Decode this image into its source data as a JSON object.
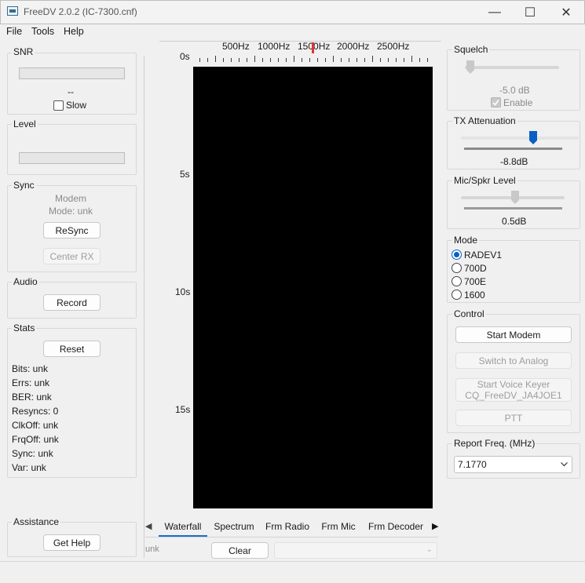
{
  "window": {
    "title": "FreeDV 2.0.2 (IC-7300.cnf)",
    "controls": {
      "minimize": "—",
      "maximize": "☐",
      "close": "✕"
    }
  },
  "menu": [
    "File",
    "Tools",
    "Help"
  ],
  "left_panel": {
    "snr": {
      "title": "SNR",
      "value": "--",
      "slow_label": "Slow",
      "slow_checked": false
    },
    "level": {
      "title": "Level"
    },
    "sync": {
      "title": "Sync",
      "modem": "Modem",
      "mode": "Mode: unk",
      "resync_label": "ReSync",
      "center_rx_label": "Center RX"
    },
    "audio": {
      "title": "Audio",
      "record_label": "Record"
    },
    "stats": {
      "title": "Stats",
      "reset_label": "Reset",
      "lines": [
        "Bits: unk",
        "Errs: unk",
        "BER: unk",
        "Resyncs: 0",
        "ClkOff: unk",
        "FrqOff: unk",
        "Sync: unk",
        "Var: unk"
      ]
    },
    "assistance": {
      "title": "Assistance",
      "help_label": "Get Help"
    }
  },
  "center": {
    "freq_labels": [
      "500Hz",
      "1000Hz",
      "1500Hz",
      "2000Hz",
      "2500Hz"
    ],
    "time_labels": [
      "0s",
      "5s",
      "10s",
      "15s"
    ],
    "tabs": [
      "Waterfall",
      "Spectrum",
      "Frm Radio",
      "Frm Mic",
      "Frm Decoder"
    ],
    "active_tab": "Waterfall",
    "status_text": "unk",
    "clear_label": "Clear"
  },
  "right_panel": {
    "squelch": {
      "title": "Squelch",
      "value": "-5.0 dB",
      "enable_label": "Enable",
      "enabled": true
    },
    "tx_attenuation": {
      "title": "TX Attenuation",
      "value": "-8.8dB"
    },
    "mic_spkr": {
      "title": "Mic/Spkr Level",
      "value": "0.5dB"
    },
    "mode": {
      "title": "Mode",
      "options": [
        "RADEV1",
        "700D",
        "700E",
        "1600"
      ],
      "selected": "RADEV1"
    },
    "control": {
      "title": "Control",
      "start_modem": "Start Modem",
      "switch_analog": "Switch to Analog",
      "voice_keyer_line1": "Start Voice Keyer",
      "voice_keyer_line2": "CQ_FreeDV_JA4JOE1",
      "ptt": "PTT"
    },
    "report_freq": {
      "title": "Report Freq. (MHz)",
      "value": "7.1770"
    }
  },
  "colors": {
    "accent": "#0a5fc4",
    "marker": "#e03535",
    "waterfall_bg": "#000000"
  }
}
